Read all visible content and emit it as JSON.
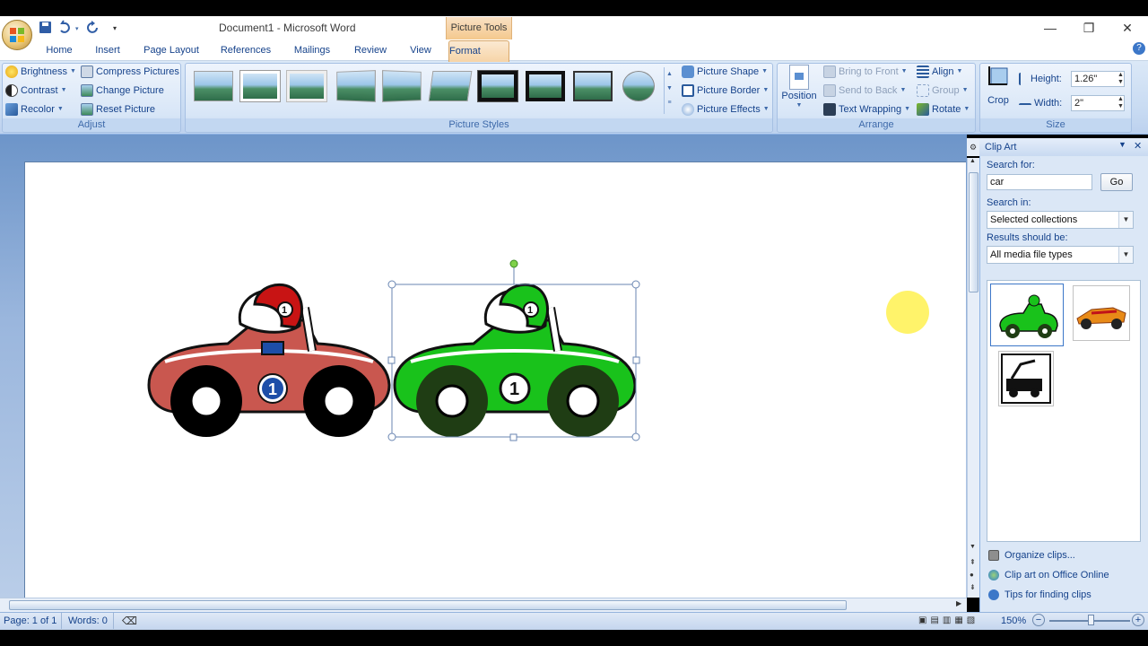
{
  "window": {
    "title": "Document1 - Microsoft Word",
    "context_tab": "Picture Tools",
    "minimize": "—",
    "restore": "❐",
    "close": "✕"
  },
  "tabs": [
    "Home",
    "Insert",
    "Page Layout",
    "References",
    "Mailings",
    "Review",
    "View",
    "Format"
  ],
  "ribbon": {
    "adjust": {
      "label": "Adjust",
      "brightness": "Brightness",
      "contrast": "Contrast",
      "recolor": "Recolor",
      "compress": "Compress Pictures",
      "change": "Change Picture",
      "reset": "Reset Picture"
    },
    "styles": {
      "label": "Picture Styles",
      "shape": "Picture Shape",
      "border": "Picture Border",
      "effects": "Picture Effects"
    },
    "arrange": {
      "label": "Arrange",
      "position": "Position",
      "bring_front": "Bring to Front",
      "send_back": "Send to Back",
      "text_wrapping": "Text Wrapping",
      "align": "Align",
      "group": "Group",
      "rotate": "Rotate"
    },
    "size": {
      "label": "Size",
      "crop": "Crop",
      "height_label": "Height:",
      "height_value": "1.26\"",
      "width_label": "Width:",
      "width_value": "2\""
    }
  },
  "clip_art": {
    "title": "Clip Art",
    "search_for_label": "Search for:",
    "search_value": "car",
    "go": "Go",
    "search_in_label": "Search in:",
    "search_in_value": "Selected collections",
    "results_label": "Results should be:",
    "results_value": "All media file types",
    "links": [
      "Organize clips...",
      "Clip art on Office Online",
      "Tips for finding clips"
    ]
  },
  "status": {
    "page": "Page: 1 of 1",
    "words": "Words: 0",
    "zoom": "150%"
  },
  "colors": {
    "red_car": "#c9574f",
    "red_helmet": "#c81414",
    "green_car": "#19c21b",
    "dark_wheel": "#1f3d14",
    "highlight": "#fff25a"
  }
}
